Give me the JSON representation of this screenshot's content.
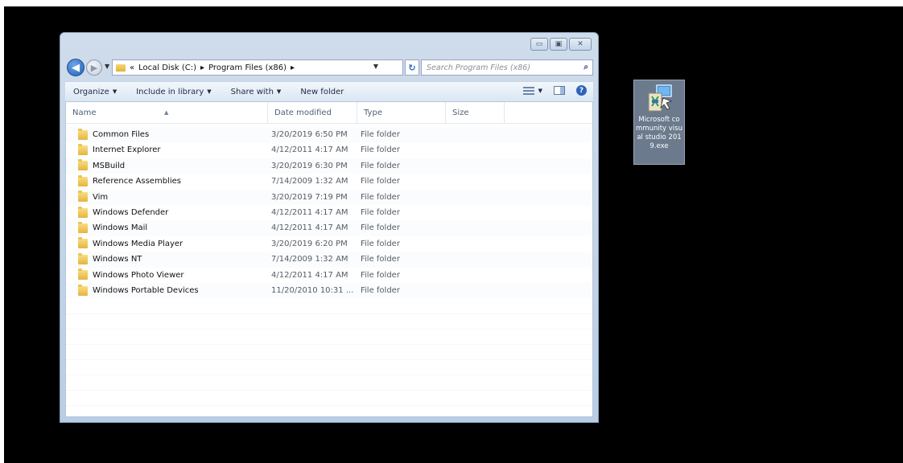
{
  "window": {
    "caption_buttons": {
      "minimize": "▭",
      "maximize": "▣",
      "close": "✕"
    },
    "address": {
      "overflow": "«",
      "segments": [
        "Local Disk (C:)",
        "▸",
        "Program Files (x86)",
        "▸"
      ],
      "refresh_glyph": "↻"
    },
    "search": {
      "placeholder": "Search Program Files (x86)"
    },
    "toolbar": {
      "organize": "Organize",
      "include_in_library": "Include in library",
      "share_with": "Share with",
      "new_folder": "New folder"
    },
    "columns": {
      "name": "Name",
      "date_modified": "Date modified",
      "type": "Type",
      "size": "Size"
    },
    "files": [
      {
        "name": "Common Files",
        "date": "3/20/2019 6:50 PM",
        "type": "File folder"
      },
      {
        "name": "Internet Explorer",
        "date": "4/12/2011 4:17 AM",
        "type": "File folder"
      },
      {
        "name": "MSBuild",
        "date": "3/20/2019 6:30 PM",
        "type": "File folder"
      },
      {
        "name": "Reference Assemblies",
        "date": "7/14/2009 1:32 AM",
        "type": "File folder"
      },
      {
        "name": "Vim",
        "date": "3/20/2019 7:19 PM",
        "type": "File folder"
      },
      {
        "name": "Windows Defender",
        "date": "4/12/2011 4:17 AM",
        "type": "File folder"
      },
      {
        "name": "Windows Mail",
        "date": "4/12/2011 4:17 AM",
        "type": "File folder"
      },
      {
        "name": "Windows Media Player",
        "date": "3/20/2019 6:20 PM",
        "type": "File folder"
      },
      {
        "name": "Windows NT",
        "date": "7/14/2009 1:32 AM",
        "type": "File folder"
      },
      {
        "name": "Windows Photo Viewer",
        "date": "4/12/2011 4:17 AM",
        "type": "File folder"
      },
      {
        "name": "Windows Portable Devices",
        "date": "11/20/2010 10:31 ...",
        "type": "File folder"
      }
    ]
  },
  "desktop_icon": {
    "label": "Microsoft community visual studio 2019.exe",
    "icon": "installer-icon"
  }
}
